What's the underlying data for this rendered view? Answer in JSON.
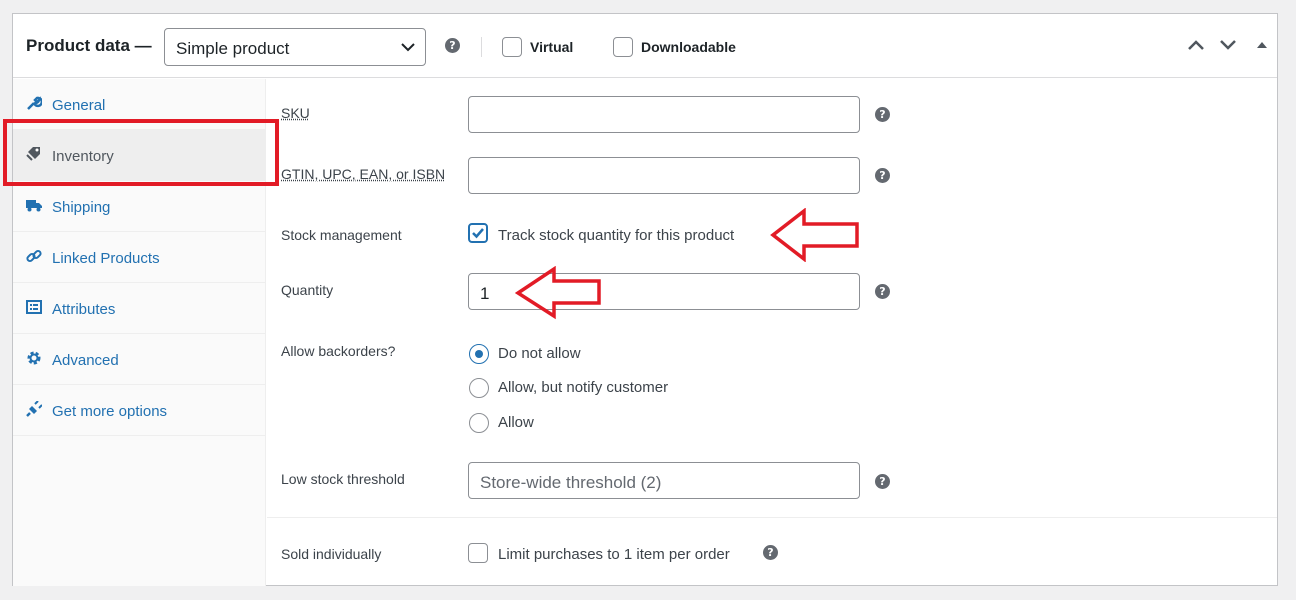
{
  "header": {
    "title": "Product data —",
    "product_type": "Simple product",
    "help": "?",
    "virtual_label": "Virtual",
    "downloadable_label": "Downloadable"
  },
  "sidebar": {
    "items": [
      {
        "label": "General",
        "icon": "wrench-icon"
      },
      {
        "label": "Inventory",
        "icon": "tag-icon"
      },
      {
        "label": "Shipping",
        "icon": "truck-icon"
      },
      {
        "label": "Linked Products",
        "icon": "link-icon"
      },
      {
        "label": "Attributes",
        "icon": "list-icon"
      },
      {
        "label": "Advanced",
        "icon": "gear-icon"
      },
      {
        "label": "Get more options",
        "icon": "plug-icon"
      }
    ],
    "active": "Inventory"
  },
  "form": {
    "sku": {
      "label": "SKU",
      "value": ""
    },
    "gtin": {
      "label": "GTIN, UPC, EAN, or ISBN",
      "value": ""
    },
    "stock_management": {
      "label": "Stock management",
      "checkbox_label": "Track stock quantity for this product",
      "checked": true
    },
    "quantity": {
      "label": "Quantity",
      "value": "1"
    },
    "backorders": {
      "label": "Allow backorders?",
      "options": [
        "Do not allow",
        "Allow, but notify customer",
        "Allow"
      ],
      "selected": "Do not allow"
    },
    "low_stock": {
      "label": "Low stock threshold",
      "placeholder": "Store-wide threshold (2)"
    },
    "sold_individually": {
      "label": "Sold individually",
      "checkbox_label": "Limit purchases to 1 item per order",
      "checked": false
    }
  },
  "colors": {
    "annotation": "#e21b26",
    "accent": "#2271b1",
    "help_icon": "#646970"
  }
}
